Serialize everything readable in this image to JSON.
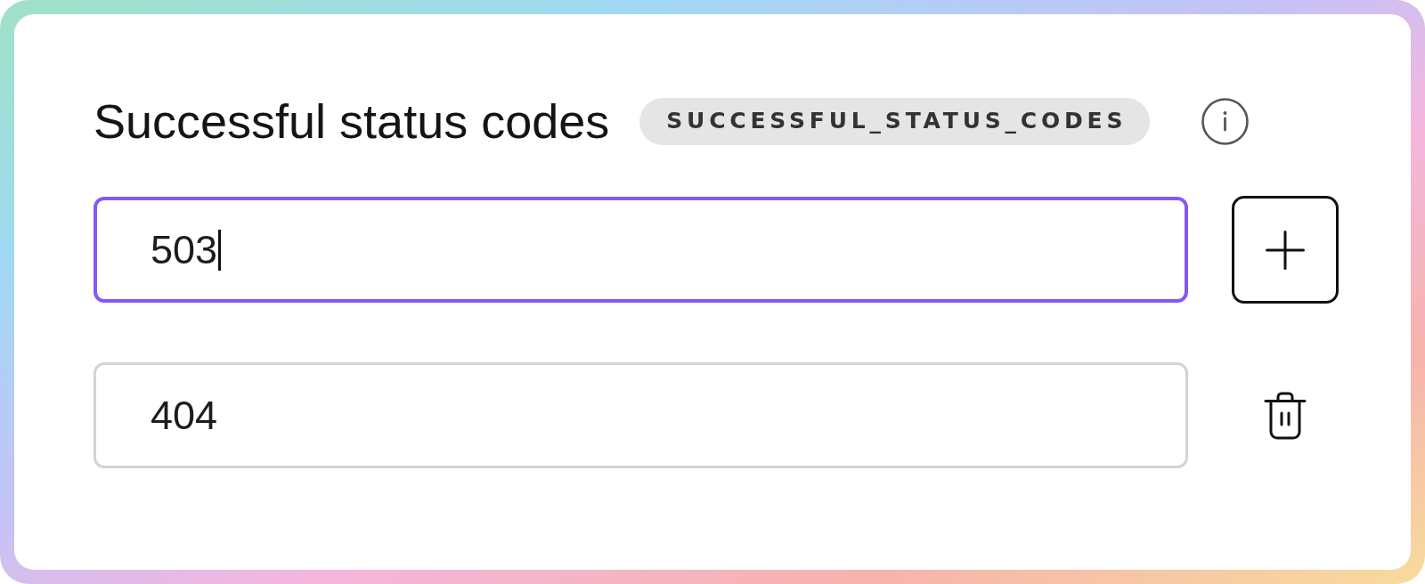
{
  "field": {
    "title": "Successful status codes",
    "key_badge": "SUCCESSFUL_STATUS_CODES"
  },
  "entries": [
    {
      "kind": "new",
      "value": "503",
      "focused": true
    },
    {
      "kind": "existing",
      "value": "404",
      "focused": false
    }
  ]
}
